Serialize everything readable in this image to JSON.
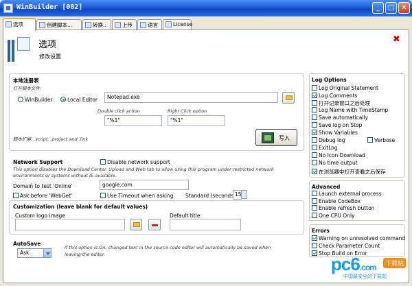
{
  "window": {
    "title": "WinBuilder [082]",
    "min": "_",
    "max": "□",
    "close": "✕"
  },
  "tabs": [
    {
      "label": "选项",
      "active": true
    },
    {
      "label": "创建脚本..."
    },
    {
      "label": "转换.."
    },
    {
      "label": "上传"
    },
    {
      "label": "语言"
    },
    {
      "label": "License"
    }
  ],
  "header": {
    "title": "选项",
    "subtitle": "修改设置",
    "close": "✖"
  },
  "registry": {
    "title": "本地注册表",
    "open_with_label": "打开脚本文件:",
    "radio_winbuilder": "WinBuilder",
    "radio_local_editor": "Local Editor",
    "editor_value": "Notepad.exe",
    "double_click_label": "Double click action",
    "double_click_value": "\"%1\"",
    "right_click_label": "Right Click option",
    "right_click_value": "\"%1\"",
    "note": "脚本扩展: .script, .project and .link",
    "write_button": "写入"
  },
  "network": {
    "title": "Network Support",
    "disable_label": "Disable network support",
    "description": "This option disables the Download Center, Upload and Web tab to allow using this program under restricted network environments or systems without IE available.",
    "domain_label": "Domain to test 'Online'",
    "domain_value": "google.com",
    "ask_webget": "Ask before 'WebGet'",
    "use_timeout": "Use Timeout when asking",
    "standard_label": "Standard (seconds)",
    "standard_value": "15"
  },
  "custom": {
    "title": "Customization (leave blank for default values)",
    "logo_label": "Custom logo image",
    "default_title_label": "Default title"
  },
  "autosave": {
    "title": "AutoSave",
    "value": "Ask",
    "note": "If this option is On, changed text in the source code editor will automatically be saved  when leaving the editor."
  },
  "log": {
    "title": "Log Options",
    "items": [
      {
        "label": "Log Original Statement",
        "checked": false
      },
      {
        "label": "Log Comments",
        "checked": true
      },
      {
        "label": "打开记录窗口之后处理",
        "checked": false
      },
      {
        "label": "Log Name with TimeStamp",
        "checked": false
      },
      {
        "label": "Save automatically",
        "checked": false
      },
      {
        "label": "Save log on Stop",
        "checked": false
      },
      {
        "label": "Show Variables",
        "checked": true
      },
      {
        "label": "Debug log",
        "checked": false
      },
      {
        "label": "ExitLog",
        "checked": false
      },
      {
        "label": "No Icon Download",
        "checked": false
      },
      {
        "label": "No time output",
        "checked": false
      },
      {
        "label": "在浏览器中打开查看之后保存",
        "checked": true
      }
    ],
    "verbose": {
      "label": "Verbose",
      "checked": false
    }
  },
  "advanced": {
    "title": "Advanced",
    "items": [
      {
        "label": "Launch external process",
        "checked": false
      },
      {
        "label": "Enable CodeBox",
        "checked": false
      },
      {
        "label": "Enable refresh button",
        "checked": false
      },
      {
        "label": "One CPU Only",
        "checked": false
      }
    ]
  },
  "errors": {
    "title": "Errors",
    "items": [
      {
        "label": "Warning on unresolved command",
        "checked": true
      },
      {
        "label": "Check Parameter Count",
        "checked": false
      },
      {
        "label": "Stop Build on Error",
        "checked": true
      }
    ]
  },
  "watermark": {
    "text": "pc6",
    "suffix": ".com",
    "badge": "下载站",
    "sub": "中国最安全的下载站"
  },
  "colors": {
    "titlebar": "#0b45c4",
    "check": "#21a121",
    "tab_highlight": "#f2a63b",
    "close": "#cc0000"
  }
}
